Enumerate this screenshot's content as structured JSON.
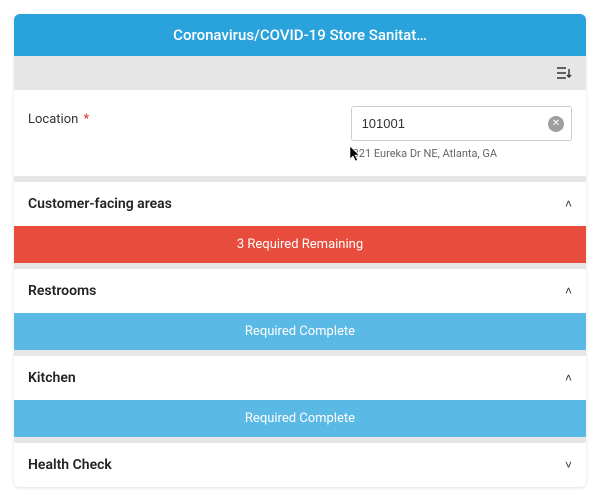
{
  "header": {
    "title": "Coronavirus/COVID-19 Store Sanitat…"
  },
  "location": {
    "label": "Location",
    "required_marker": "*",
    "value": "101001",
    "address": "321 Eureka Dr NE,  Atlanta, GA"
  },
  "sections": [
    {
      "title": "Customer-facing areas",
      "expanded": true,
      "status_text": "3 Required Remaining",
      "status_type": "red"
    },
    {
      "title": "Restrooms",
      "expanded": true,
      "status_text": "Required Complete",
      "status_type": "blue"
    },
    {
      "title": "Kitchen",
      "expanded": true,
      "status_text": "Required Complete",
      "status_type": "blue"
    },
    {
      "title": "Health Check",
      "expanded": false,
      "status_text": "",
      "status_type": ""
    }
  ],
  "icons": {
    "chevron_up": "˄",
    "chevron_down": "˅",
    "clear": "✕"
  }
}
